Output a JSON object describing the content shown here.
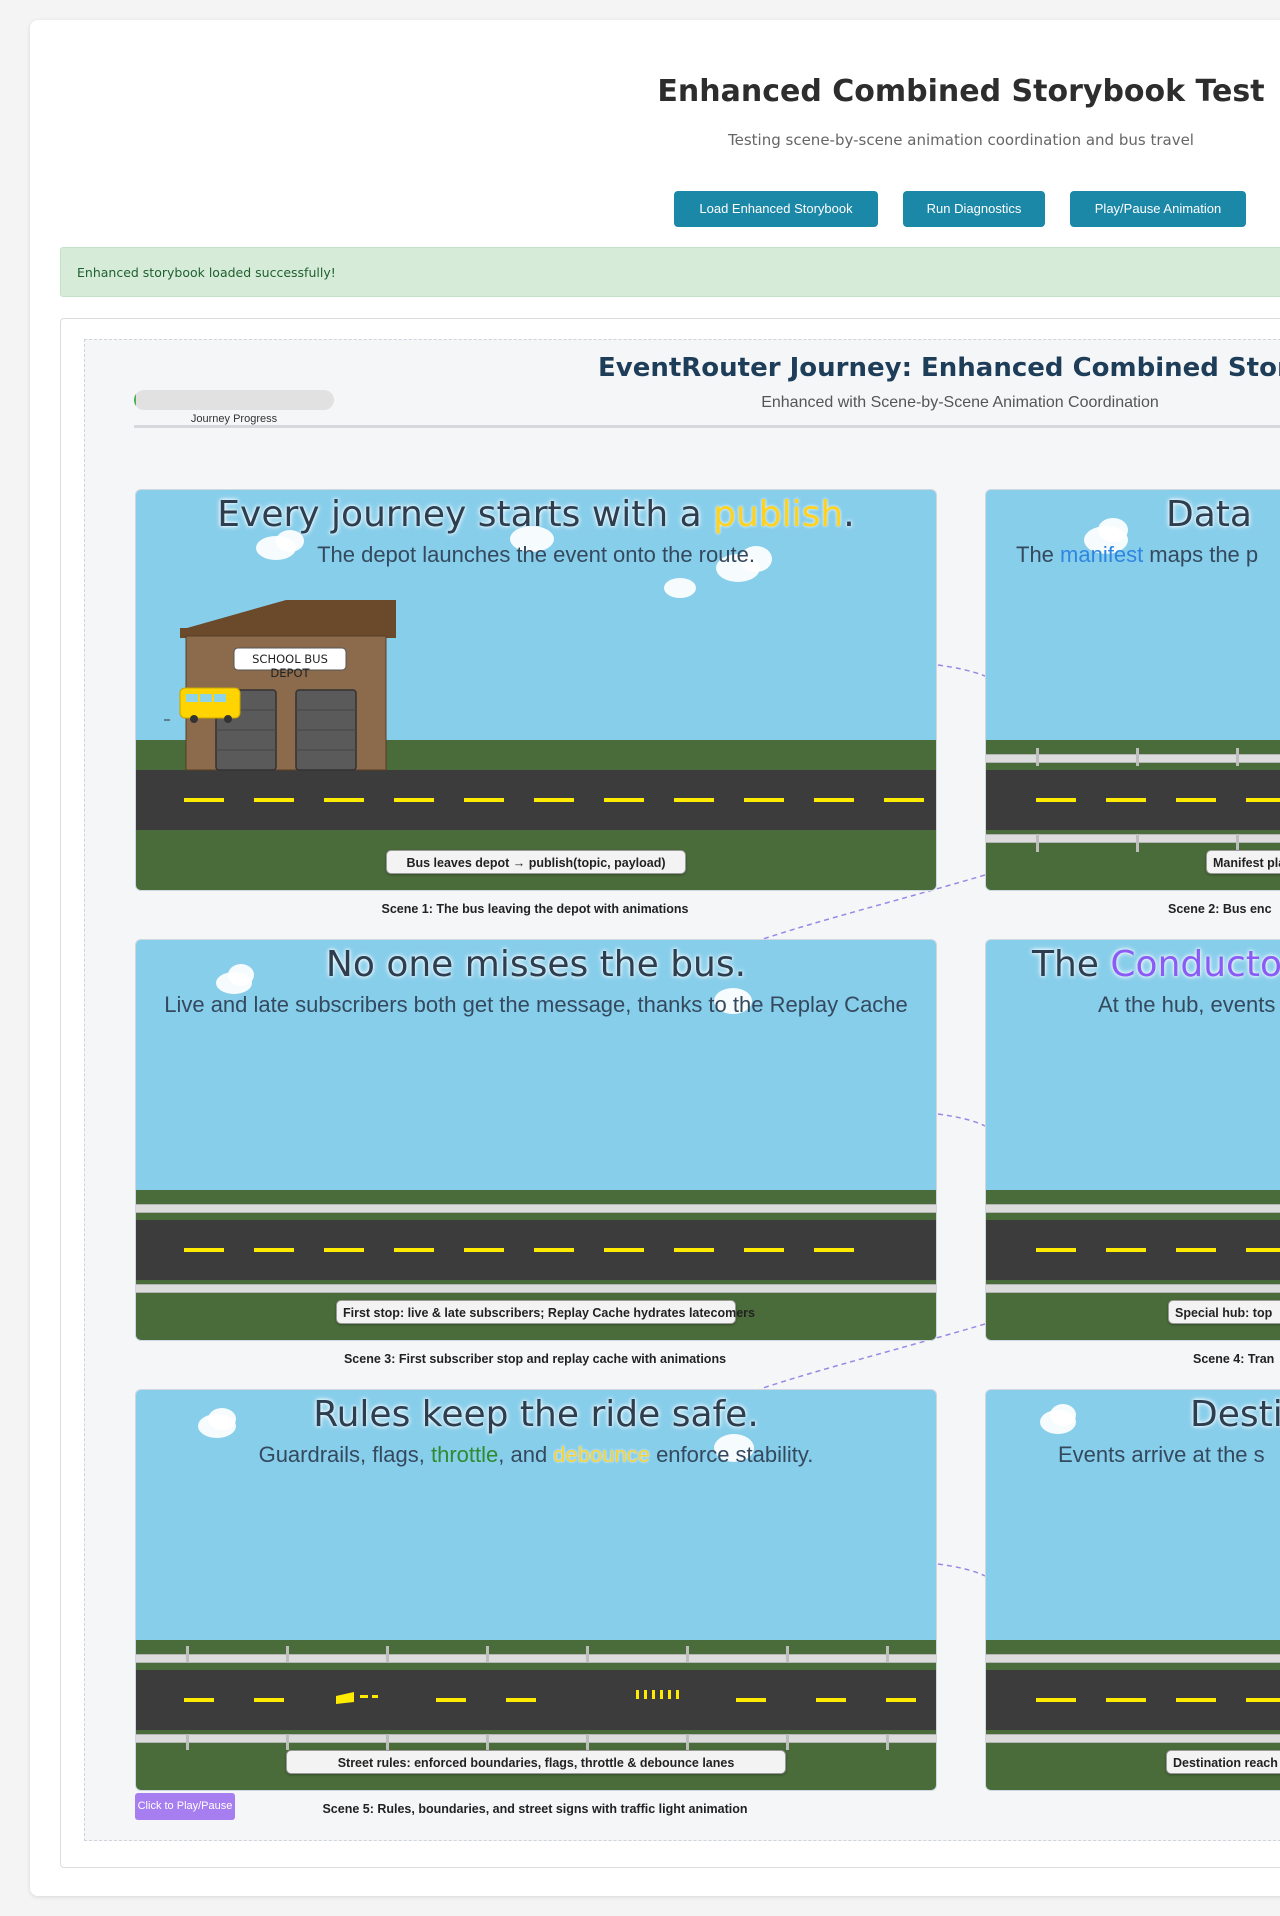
{
  "header": {
    "title": "Enhanced Combined Storybook Test",
    "subtitle": "Testing scene-by-scene animation coordination and bus travel"
  },
  "toolbar": {
    "load_label": "Load Enhanced Storybook",
    "diagnostics_label": "Run Diagnostics",
    "play_pause_label": "Play/Pause Animation"
  },
  "status": {
    "message": "Enhanced storybook loaded successfully!",
    "type": "success"
  },
  "storybook": {
    "title": "EventRouter Journey: Enhanced Combined Storybo",
    "subtitle": "Enhanced with Scene-by-Scene Animation Coordination",
    "progress_label": "Journey Progress",
    "progress_fraction": 0.01,
    "play_toggle_label": "Click to Play/Pause"
  },
  "scenes": [
    {
      "headline_pre": "Every journey starts with a ",
      "headline_hl": "publish",
      "headline_post": ".",
      "subline_pre": "The depot launches the event onto the route.",
      "sign": "Bus leaves depot → publish(topic, payload)",
      "caption": "Scene 1: The bus leaving the depot with animations",
      "depot_sign": "SCHOOL BUS DEPOT"
    },
    {
      "headline_pre": "Data",
      "subline_pre": "The ",
      "subline_hl": "manifest",
      "subline_post": " maps the p",
      "sign": "Manifest plan",
      "caption": "Scene 2: Bus enc"
    },
    {
      "headline_pre": "No one misses the bus.",
      "subline_pre": "Live and late subscribers both get the message, thanks to the Replay Cache",
      "sign": "First stop: live & late subscribers; Replay Cache hydrates latecomers",
      "caption": "Scene 3: First subscriber stop and replay cache with animations"
    },
    {
      "headline_pre": "The ",
      "headline_hl": "Conducto",
      "subline_pre": "At the hub, events",
      "sign": "Special hub: top",
      "caption": "Scene 4: Tran"
    },
    {
      "headline_pre": "Rules keep the ride safe.",
      "subline_pre": "Guardrails, flags, ",
      "subline_hl": "throttle",
      "subline_mid": ", and ",
      "subline_hl2": "debounce",
      "subline_post": " enforce stability.",
      "sign": "Street rules: enforced boundaries, flags, throttle & debounce lanes",
      "caption": "Scene 5: Rules, boundaries, and street signs with traffic light animation"
    },
    {
      "headline_pre": "Desti",
      "subline_pre": "Events arrive at the s",
      "sign": "Destination reach",
      "caption": ""
    }
  ],
  "colors": {
    "accent": "#1b88a8",
    "sky": "#87ceeb",
    "grass": "#4a6b3a",
    "road": "#3c3c3c",
    "lane": "#ffeb00",
    "bus": "#ffd400",
    "play_toggle": "#a77ef0"
  }
}
